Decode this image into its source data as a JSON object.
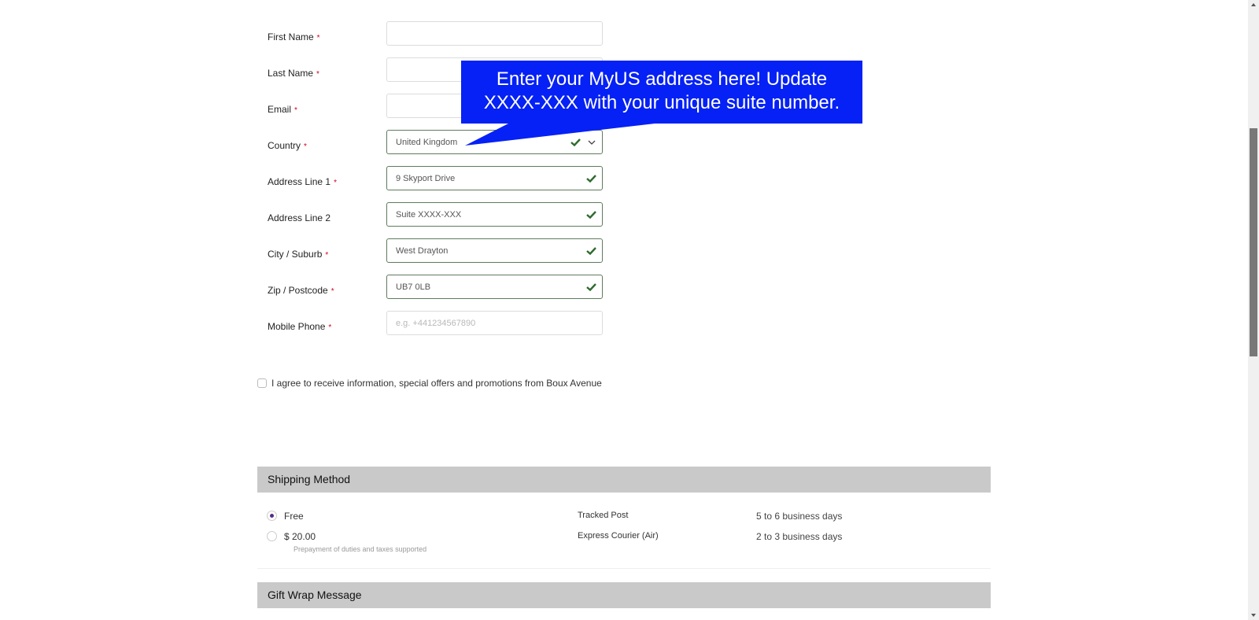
{
  "form": {
    "fields": [
      {
        "label": "First Name",
        "required": true,
        "value": "",
        "placeholder": "",
        "valid": false
      },
      {
        "label": "Last Name",
        "required": true,
        "value": "",
        "placeholder": "",
        "valid": false
      },
      {
        "label": "Email",
        "required": true,
        "value": "",
        "placeholder": "",
        "valid": false
      },
      {
        "label": "Country",
        "required": true,
        "value": "United Kingdom",
        "placeholder": "",
        "valid": true
      },
      {
        "label": "Address Line 1",
        "required": true,
        "value": "9 Skyport Drive",
        "placeholder": "",
        "valid": true
      },
      {
        "label": "Address Line 2",
        "required": false,
        "value": "Suite XXXX-XXX",
        "placeholder": "",
        "valid": true
      },
      {
        "label": "City / Suburb",
        "required": true,
        "value": "West Drayton",
        "placeholder": "",
        "valid": true
      },
      {
        "label": "Zip / Postcode",
        "required": true,
        "value": "UB7 0LB",
        "placeholder": "",
        "valid": true
      },
      {
        "label": "Mobile Phone",
        "required": true,
        "value": "",
        "placeholder": "e.g. +441234567890",
        "valid": false
      }
    ],
    "required_marker": "*",
    "agree_label": "I agree to receive information, special offers and promotions from Boux Avenue",
    "agree_checked": false
  },
  "callout": {
    "line1": "Enter your MyUS address here! Update",
    "line2": "XXXX-XXX with your unique suite number.",
    "color": "#0521f5"
  },
  "shipping": {
    "title": "Shipping Method",
    "options": [
      {
        "price": "Free",
        "carrier": "Tracked Post",
        "time": "5 to 6 business days",
        "selected": true
      },
      {
        "price": "$ 20.00",
        "carrier": "Express Courier (Air)",
        "time": "2 to 3 business days",
        "selected": false
      }
    ],
    "note": "Prepayment of duties and taxes supported",
    "accent": "#5b2a86"
  },
  "gift_wrap": {
    "title": "Gift Wrap Message"
  }
}
